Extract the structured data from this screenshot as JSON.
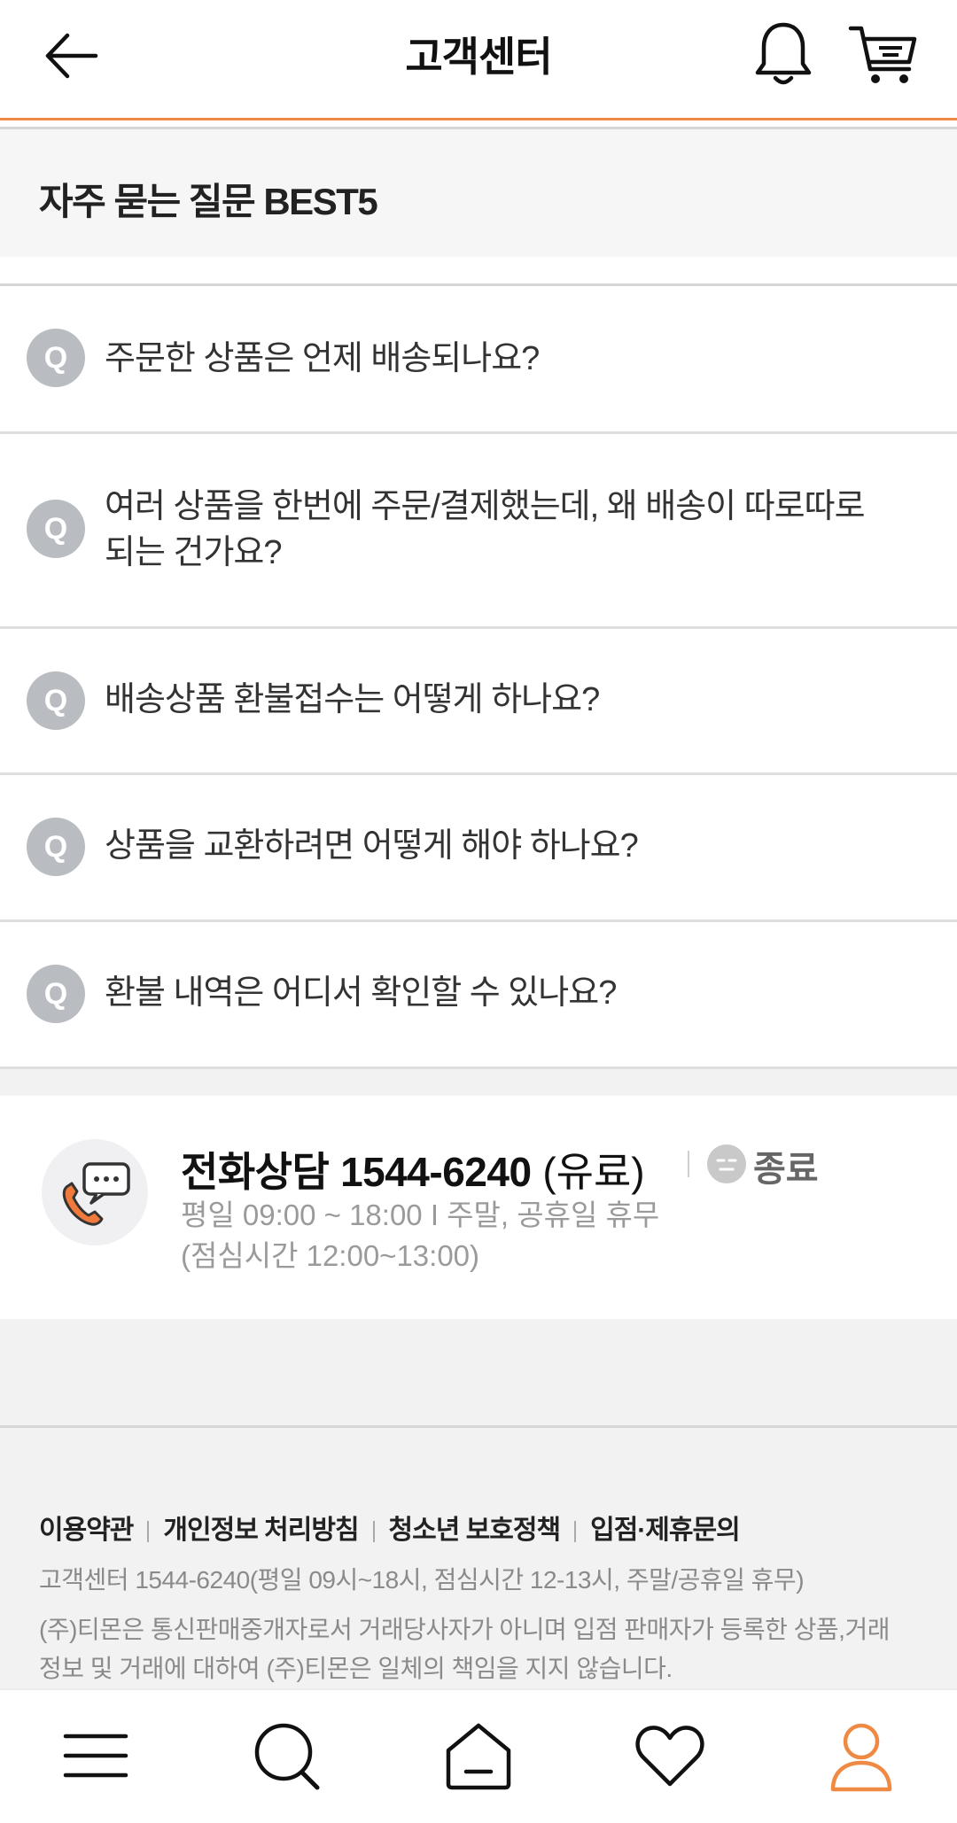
{
  "header": {
    "title": "고객센터",
    "icons": [
      "back-arrow-icon",
      "bell-icon",
      "cart-icon"
    ],
    "accent_color": "#ef8a45"
  },
  "faq": {
    "section_title": "자주 묻는 질문 BEST5",
    "badge_letter": "Q",
    "items": [
      "주문한 상품은 언제 배송되나요?",
      "여러 상품을 한번에 주문/결제했는데, 왜 배송이 따로따로 되는 건가요?",
      "배송상품 환불접수는 어떻게 하나요?",
      "상품을 교환하려면 어떻게 해야 하나요?",
      "환불 내역은 어디서 확인할 수 있나요?"
    ]
  },
  "phone": {
    "label": "전화상담",
    "number": "1544-6240",
    "fee_note": "(유료)",
    "status": "종료",
    "hours": "평일 09:00 ~ 18:00 I 주말, 공휴일 휴무",
    "lunch": "(점심시간 12:00~13:00)",
    "icon": "phone-chat-icon",
    "phone_icon_color": "#f07a3c"
  },
  "footer": {
    "links": [
      "이용약관",
      "개인정보 처리방침",
      "청소년 보호정책",
      "입점·제휴문의"
    ],
    "cs_info": "고객센터 1544-6240(평일 09시~18시, 점심시간 12-13시, 주말/공휴일 휴무)",
    "notice": "(주)티몬은 통신판매중개자로서 거래당사자가 아니며 입점 판매자가 등록한 상품,거래정보 및 거래에 대하여 (주)티몬은 일체의 책임을 지지 않습니다."
  },
  "bottom_nav": {
    "items": [
      "menu-icon",
      "search-icon",
      "home-icon",
      "heart-icon",
      "user-icon"
    ],
    "active": "user-icon",
    "active_color": "#ef8a45"
  }
}
